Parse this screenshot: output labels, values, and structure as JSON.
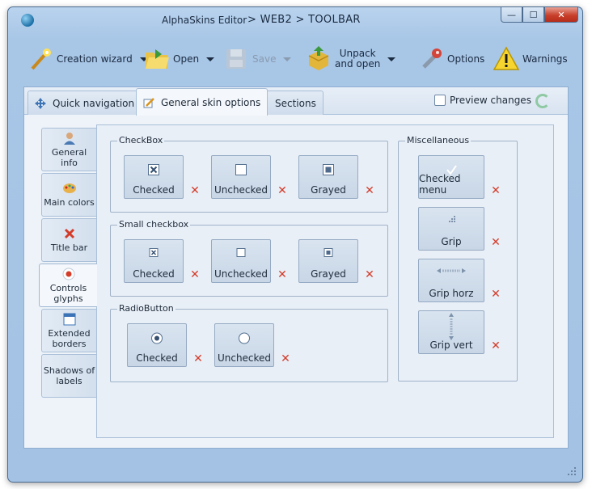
{
  "window": {
    "app_title": "AlphaSkins Editor",
    "path": "> WEB2 > TOOLBAR",
    "minimize": "—",
    "maximize": "☐",
    "close": "✕"
  },
  "toolbar": {
    "creation_wizard": "Creation wizard",
    "open": "Open",
    "save": "Save",
    "unpack_line1": "Unpack",
    "unpack_line2": "and open",
    "options": "Options",
    "warnings": "Warnings"
  },
  "tabs": {
    "quick_navigation": "Quick navigation",
    "general_skin_options": "General  skin options",
    "sections": "Sections",
    "preview_changes": "Preview changes"
  },
  "side_tabs": [
    {
      "line1": "General info",
      "line2": ""
    },
    {
      "line1": "Main colors",
      "line2": ""
    },
    {
      "line1": "Title bar",
      "line2": ""
    },
    {
      "line1": "Controls",
      "line2": "glyphs"
    },
    {
      "line1": "Extended",
      "line2": "borders"
    },
    {
      "line1": "Shadows of",
      "line2": "labels"
    }
  ],
  "groups": {
    "checkbox": {
      "title": "CheckBox",
      "checked": "Checked",
      "unchecked": "Unchecked",
      "grayed": "Grayed"
    },
    "small_checkbox": {
      "title": "Small checkbox",
      "checked": "Checked",
      "unchecked": "Unchecked",
      "grayed": "Grayed"
    },
    "radiobutton": {
      "title": "RadioButton",
      "checked": "Checked",
      "unchecked": "Unchecked"
    },
    "misc": {
      "title": "Miscellaneous",
      "checked_menu": "Checked menu",
      "grip": "Grip",
      "grip_horz": "Grip horz",
      "grip_vert": "Grip vert"
    }
  },
  "colors": {
    "accent": "#a8c6e6",
    "remove": "#d43c2a"
  }
}
